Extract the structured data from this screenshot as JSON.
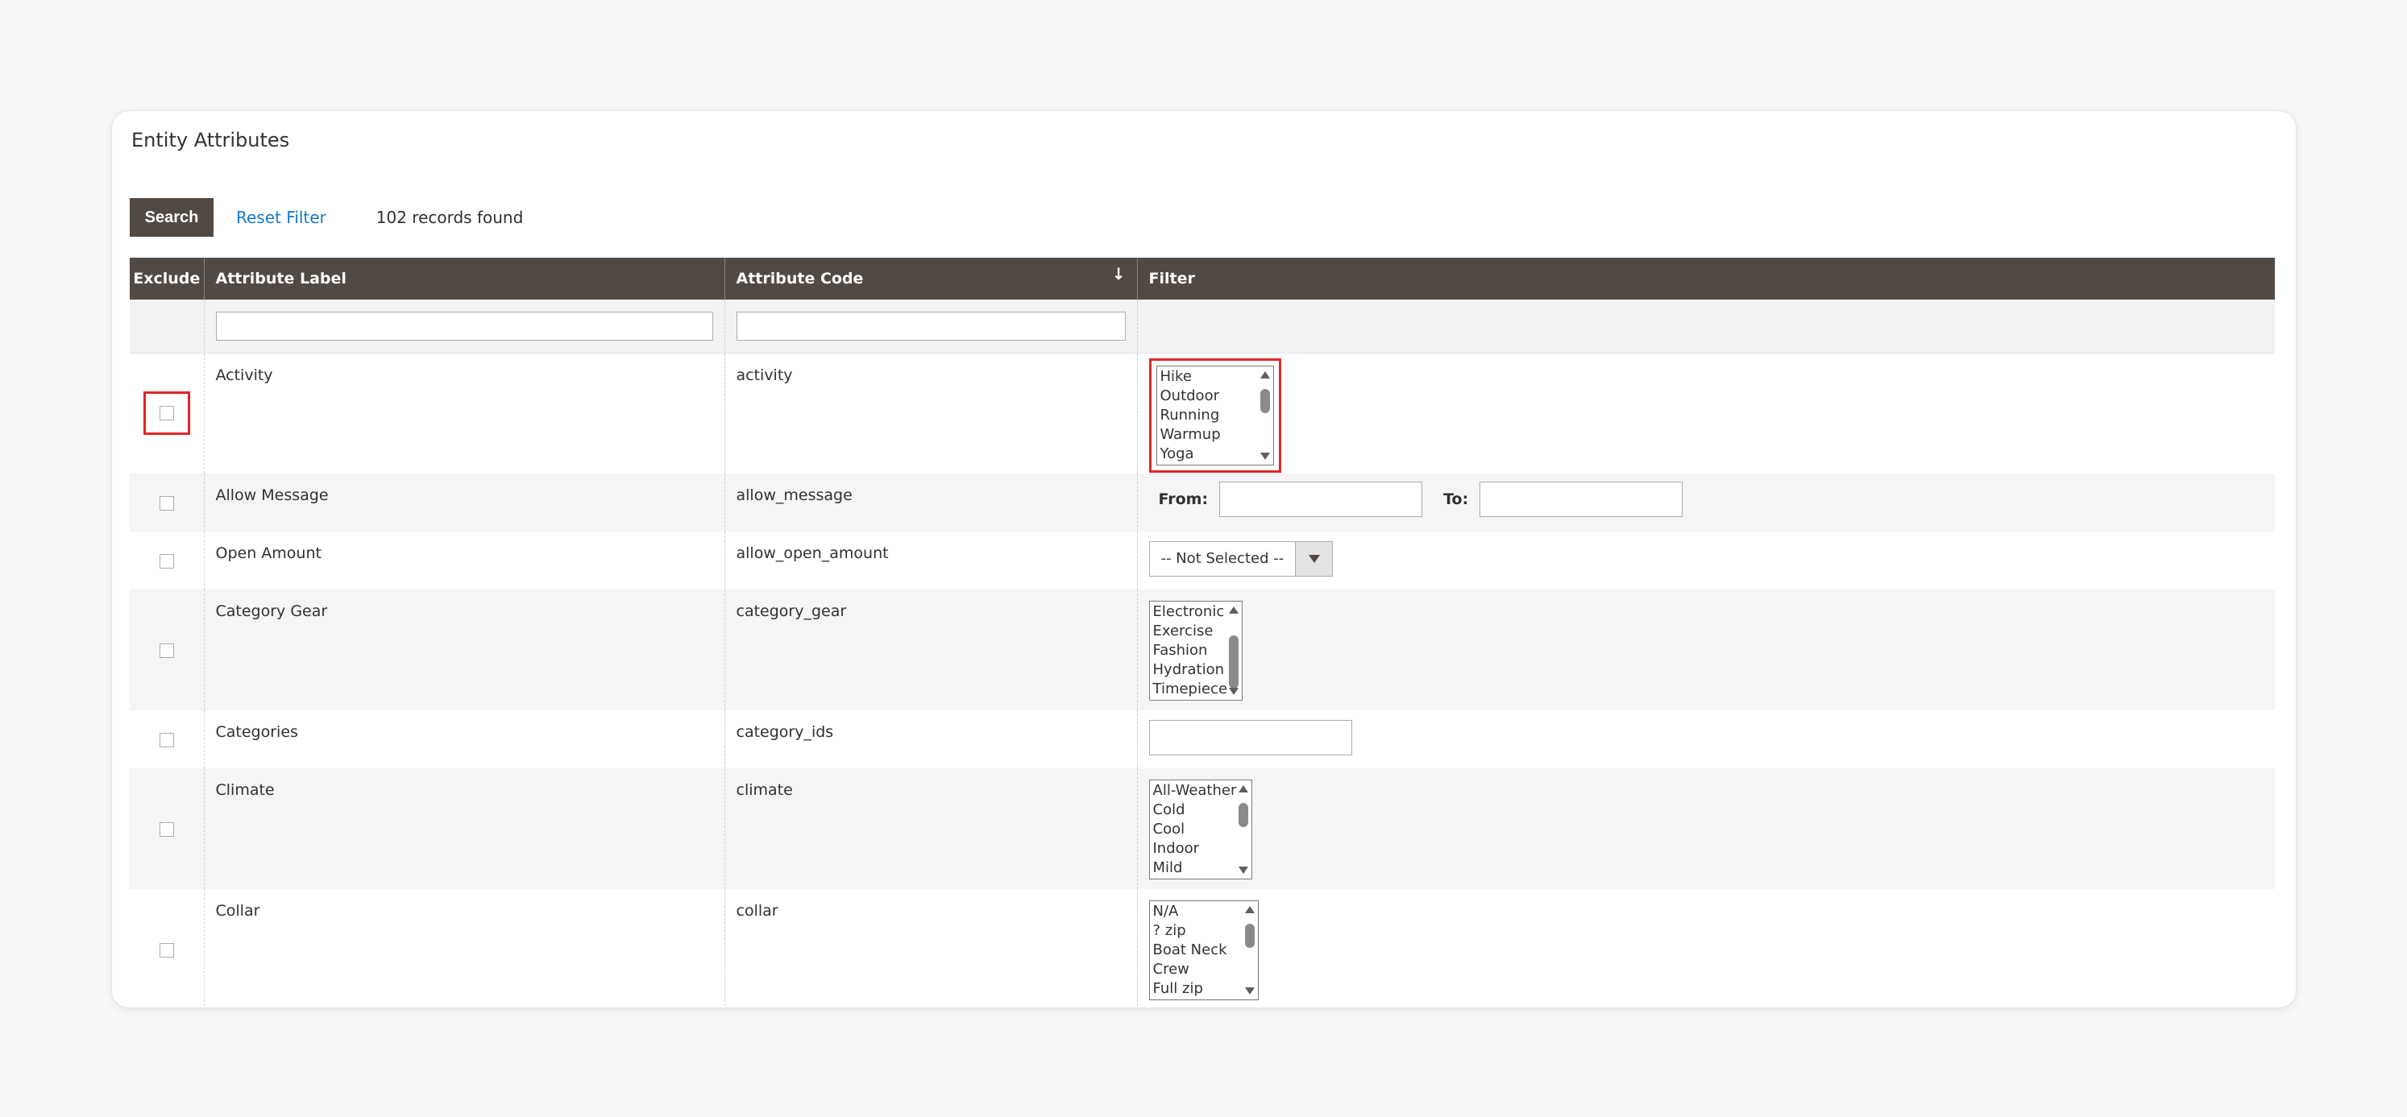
{
  "panel": {
    "title": "Entity Attributes"
  },
  "toolbar": {
    "search_label": "Search",
    "reset_label": "Reset Filter",
    "records_text": "102 records found"
  },
  "grid": {
    "headers": {
      "exclude": "Exclude",
      "label": "Attribute Label",
      "code": "Attribute Code",
      "filter": "Filter"
    },
    "sort_indicator": "↓",
    "rows": [
      {
        "label": "Activity",
        "code": "activity",
        "options": [
          "Hike",
          "Outdoor",
          "Running",
          "Warmup",
          "Yoga"
        ]
      },
      {
        "label": "Allow Message",
        "code": "allow_message",
        "from_label": "From:",
        "to_label": "To:"
      },
      {
        "label": "Open Amount",
        "code": "allow_open_amount",
        "select_value": "-- Not Selected --"
      },
      {
        "label": "Category Gear",
        "code": "category_gear",
        "options": [
          "Electronic",
          "Exercise",
          "Fashion",
          "Hydration",
          "Timepiece"
        ]
      },
      {
        "label": "Categories",
        "code": "category_ids"
      },
      {
        "label": "Climate",
        "code": "climate",
        "options": [
          "All-Weather",
          "Cold",
          "Cool",
          "Indoor",
          "Mild"
        ]
      },
      {
        "label": "Collar",
        "code": "collar",
        "options": [
          "N/A",
          "? zip",
          "Boat Neck",
          "Crew",
          "Full zip"
        ]
      }
    ]
  },
  "colors": {
    "header_bg": "#514943",
    "link": "#1979c3",
    "highlight": "#e22626"
  }
}
